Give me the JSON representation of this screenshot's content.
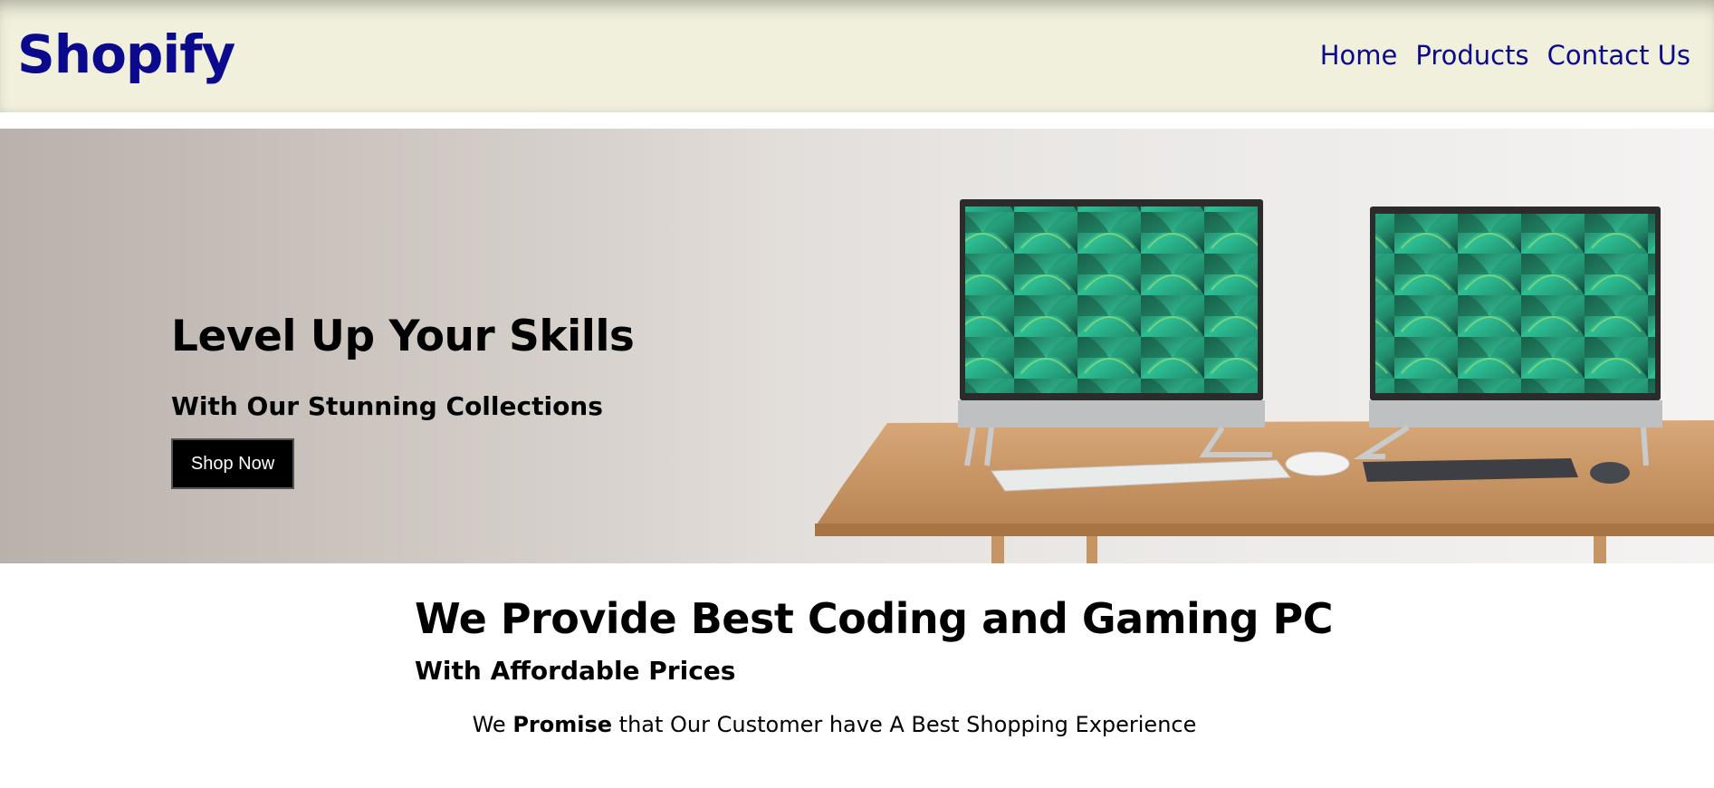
{
  "header": {
    "logo": "Shopify",
    "nav": [
      "Home",
      "Products",
      "Contact Us"
    ]
  },
  "hero": {
    "title": "Level Up Your Skills",
    "subtitle": "With Our Stunning Collections",
    "cta_label": "Shop Now"
  },
  "promo": {
    "title": "We Provide Best Coding and Gaming PC",
    "subtitle_pre": "With ",
    "subtitle_strong": "Affordable",
    "subtitle_post": " Prices",
    "text_pre": "We ",
    "text_strong": "Promise",
    "text_post": " that Our Customer have A Best Shopping Experience"
  },
  "colors": {
    "brand": "#0b0a8c",
    "header_bg": "#f1f0dc",
    "button_bg": "#000000"
  }
}
